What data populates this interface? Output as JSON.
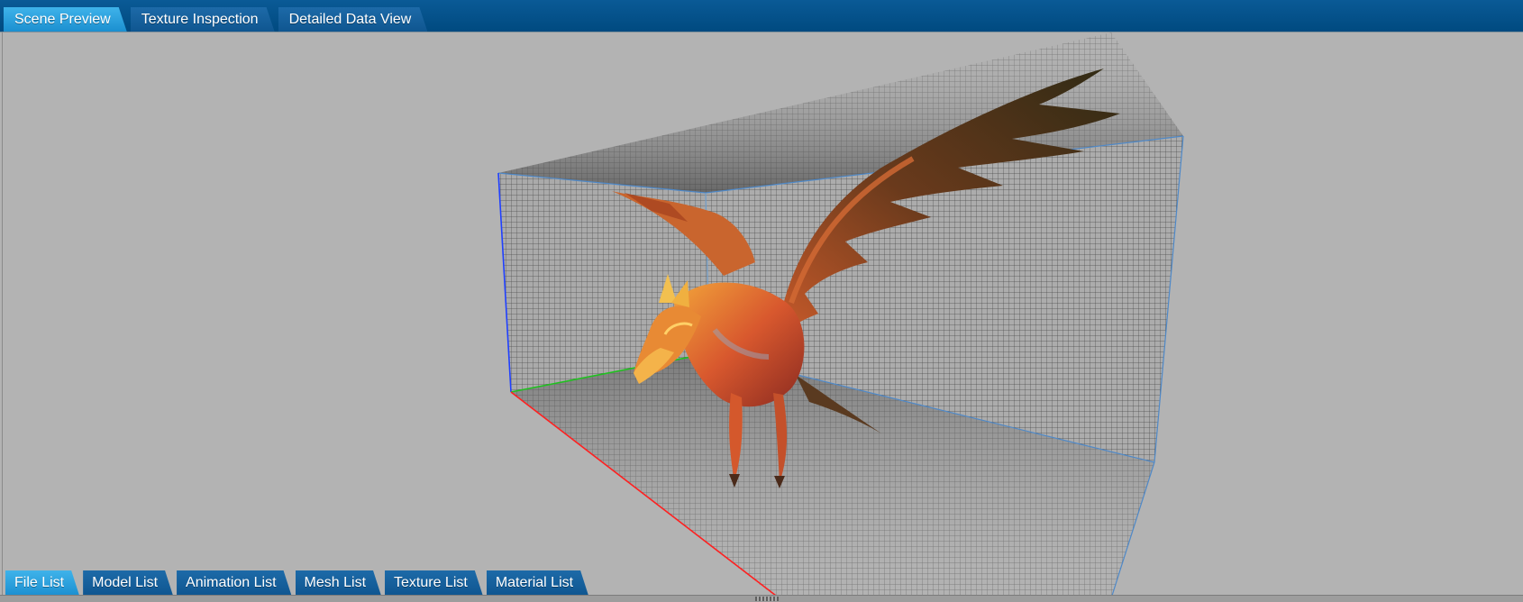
{
  "top_tabs": [
    {
      "label": "Scene Preview",
      "active": true
    },
    {
      "label": "Texture Inspection",
      "active": false
    },
    {
      "label": "Detailed Data View",
      "active": false
    }
  ],
  "bottom_tabs": [
    {
      "label": "File List",
      "active": true
    },
    {
      "label": "Model List",
      "active": false
    },
    {
      "label": "Animation List",
      "active": false
    },
    {
      "label": "Mesh List",
      "active": false
    },
    {
      "label": "Texture List",
      "active": false
    },
    {
      "label": "Material List",
      "active": false
    }
  ],
  "colors": {
    "tab_bar": "#004a80",
    "active_tab": "#2aa3de",
    "viewport_bg": "#b3b3b3",
    "axis_x": "#ff2020",
    "axis_y": "#20d020",
    "axis_z": "#2040ff"
  },
  "scene": {
    "model": "phoenix-dragon-icon"
  }
}
